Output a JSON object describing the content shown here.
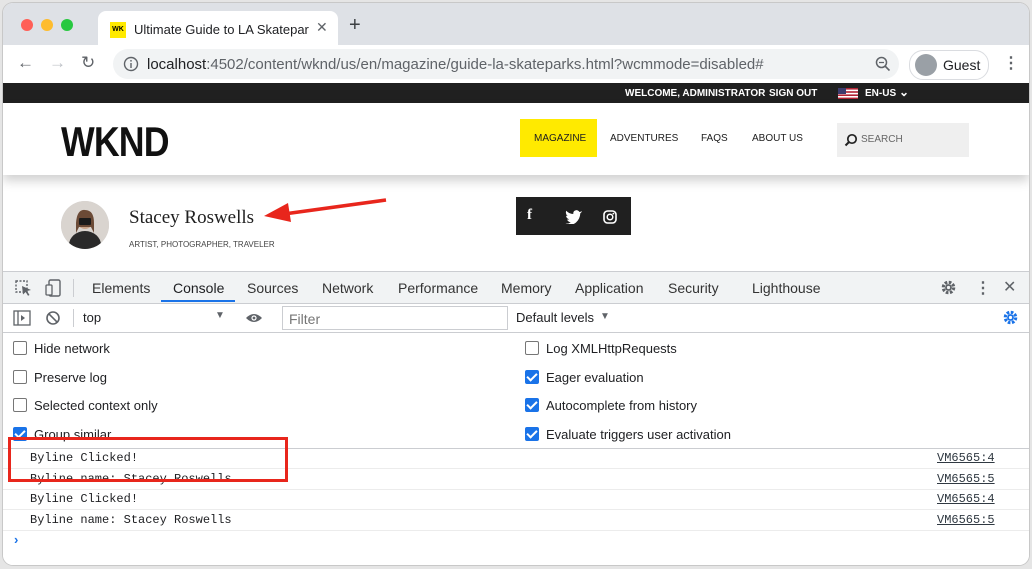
{
  "browser": {
    "tab_title": "Ultimate Guide to LA Skateparks",
    "favicon_text": "WK",
    "url_host": "localhost",
    "url_rest": ":4502/content/wknd/us/en/magazine/guide-la-skateparks.html?wcmmode=disabled#",
    "profile_label": "Guest",
    "traffic_colors": [
      "#ff5f57",
      "#febc2e",
      "#28c840"
    ]
  },
  "site": {
    "topbar": {
      "welcome": "WELCOME, ADMINISTRATOR",
      "signout": "SIGN OUT",
      "lang": "EN-US"
    },
    "logo": "WKND",
    "nav": [
      "MAGAZINE",
      "ADVENTURES",
      "FAQS",
      "ABOUT US"
    ],
    "search_placeholder": "SEARCH",
    "accent": "#ffea00"
  },
  "byline": {
    "name": "Stacey Roswells",
    "occupations": "ARTIST, PHOTOGRAPHER, TRAVELER"
  },
  "devtools": {
    "tabs": [
      "Elements",
      "Console",
      "Sources",
      "Network",
      "Performance",
      "Memory",
      "Application",
      "Security",
      "Lighthouse"
    ],
    "active_tab": "Console",
    "context": "top",
    "filter_placeholder": "Filter",
    "levels": "Default levels",
    "options_left": [
      {
        "label": "Hide network",
        "checked": false
      },
      {
        "label": "Preserve log",
        "checked": false
      },
      {
        "label": "Selected context only",
        "checked": false
      },
      {
        "label": "Group similar",
        "checked": true
      }
    ],
    "options_right": [
      {
        "label": "Log XMLHttpRequests",
        "checked": false
      },
      {
        "label": "Eager evaluation",
        "checked": true
      },
      {
        "label": "Autocomplete from history",
        "checked": true
      },
      {
        "label": "Evaluate triggers user activation",
        "checked": true
      }
    ],
    "logs": [
      {
        "msg": "Byline Clicked!",
        "src": "VM6565:4"
      },
      {
        "msg": "Byline name: Stacey Roswells",
        "src": "VM6565:5"
      },
      {
        "msg": "Byline Clicked!",
        "src": "VM6565:4"
      },
      {
        "msg": "Byline name: Stacey Roswells",
        "src": "VM6565:5"
      }
    ]
  },
  "annotation_color": "#e8261c"
}
